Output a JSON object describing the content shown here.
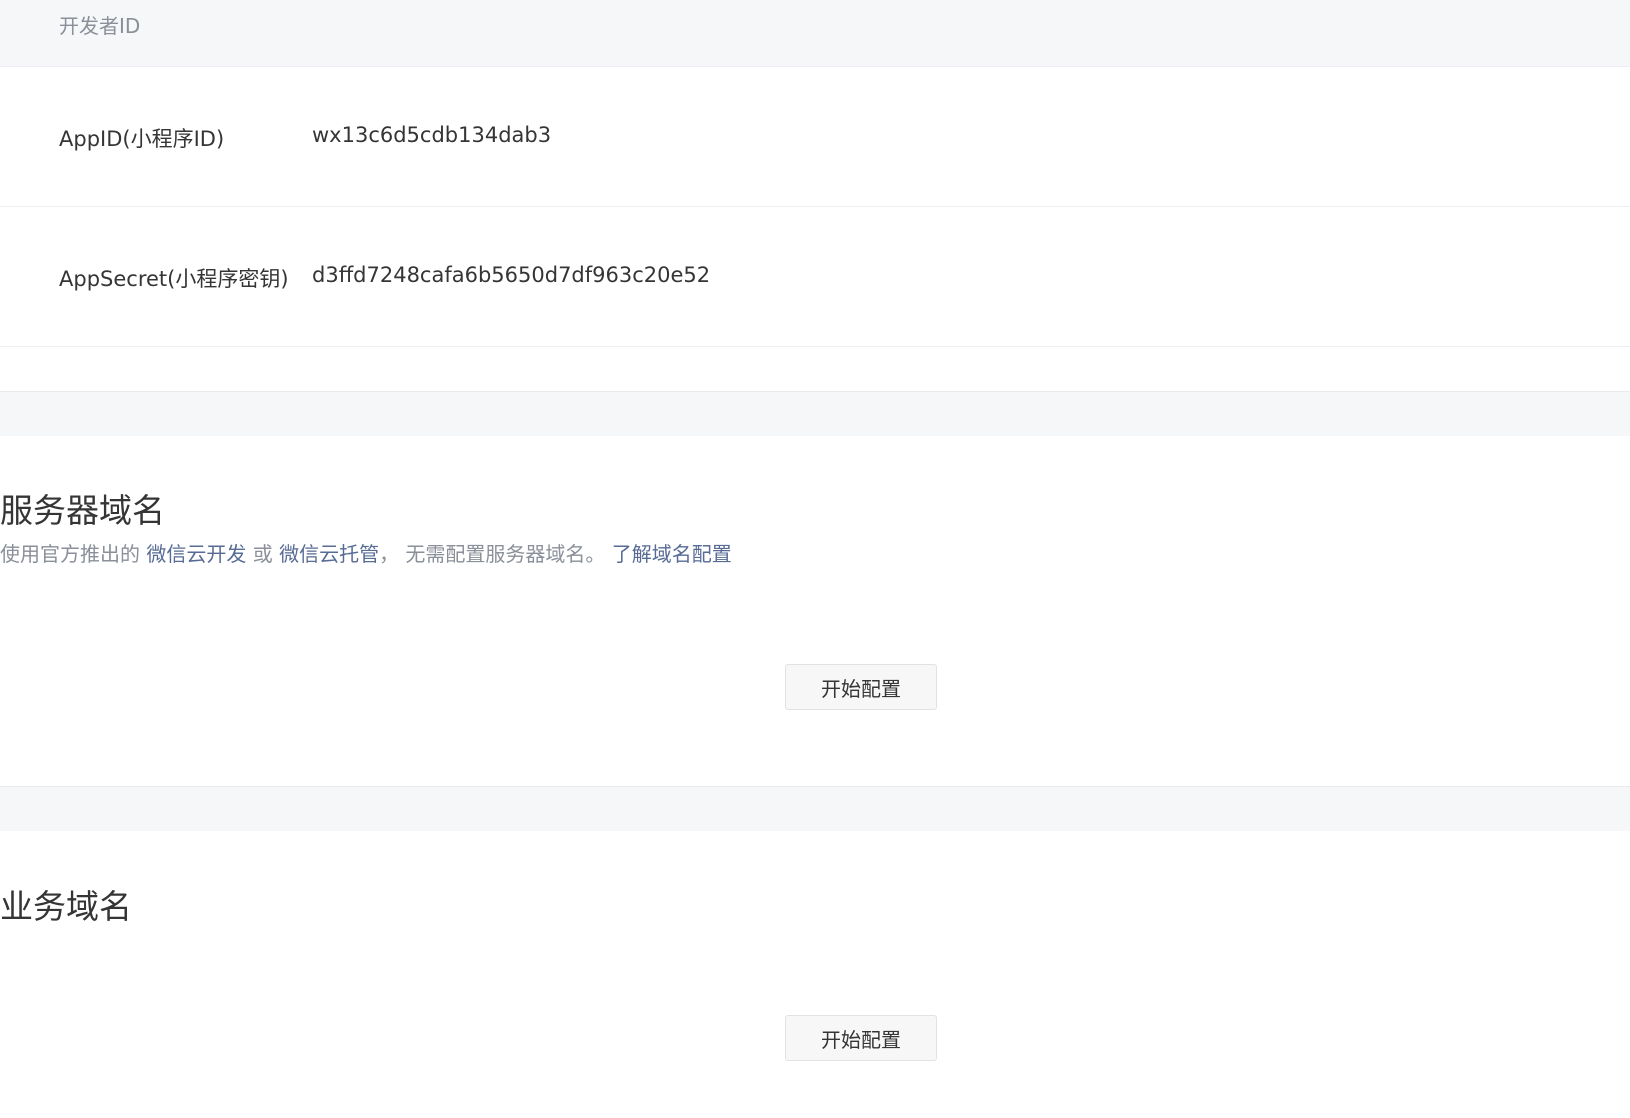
{
  "developer_id": {
    "section_label": "开发者ID",
    "rows": [
      {
        "label": "AppID(小程序ID)",
        "value": "wx13c6d5cdb134dab3"
      },
      {
        "label": "AppSecret(小程序密钥)",
        "value": "d3ffd7248cafa6b5650d7df963c20e52"
      }
    ]
  },
  "server_domain": {
    "title": "服务器域名",
    "desc_prefix": "使用官方推出的 ",
    "desc_link1": "微信云开发",
    "desc_or": " 或 ",
    "desc_link2": "微信云托管",
    "desc_suffix": "， 无需配置服务器域名。 ",
    "desc_link3": "了解域名配置",
    "button_label": "开始配置"
  },
  "business_domain": {
    "title": "业务域名",
    "button_label": "开始配置"
  },
  "colors": {
    "link": "#576b95",
    "muted_text": "#8a8f99",
    "band_background": "#f6f7f9"
  }
}
